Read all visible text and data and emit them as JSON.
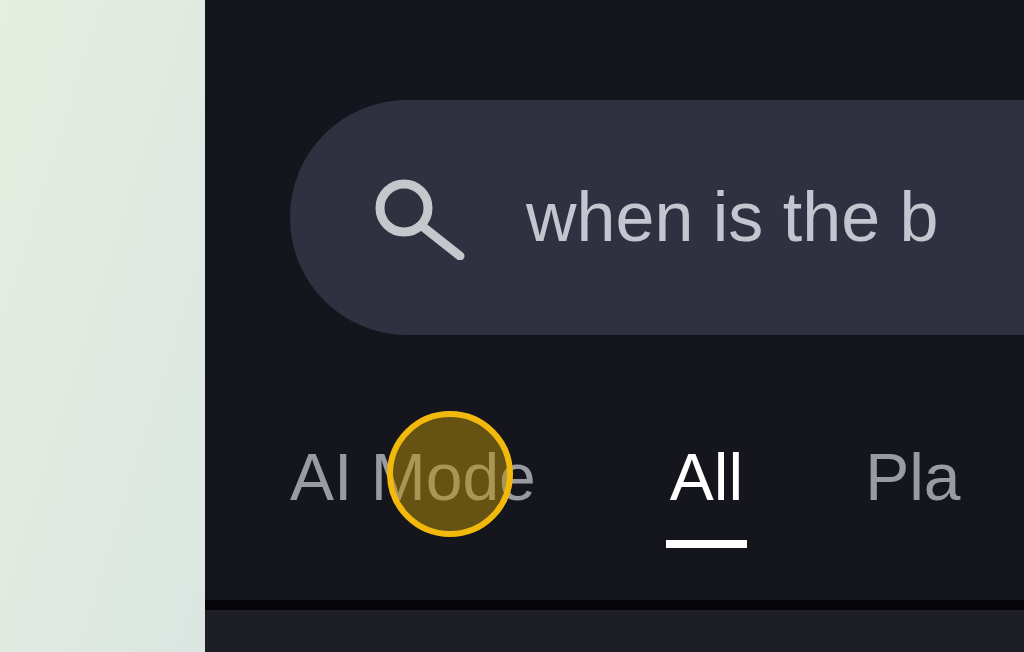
{
  "search": {
    "value": "when is the b"
  },
  "tabs": [
    {
      "label": "AI Mode",
      "selected": false
    },
    {
      "label": "All",
      "selected": true
    },
    {
      "label": "Pla",
      "selected": false
    }
  ]
}
